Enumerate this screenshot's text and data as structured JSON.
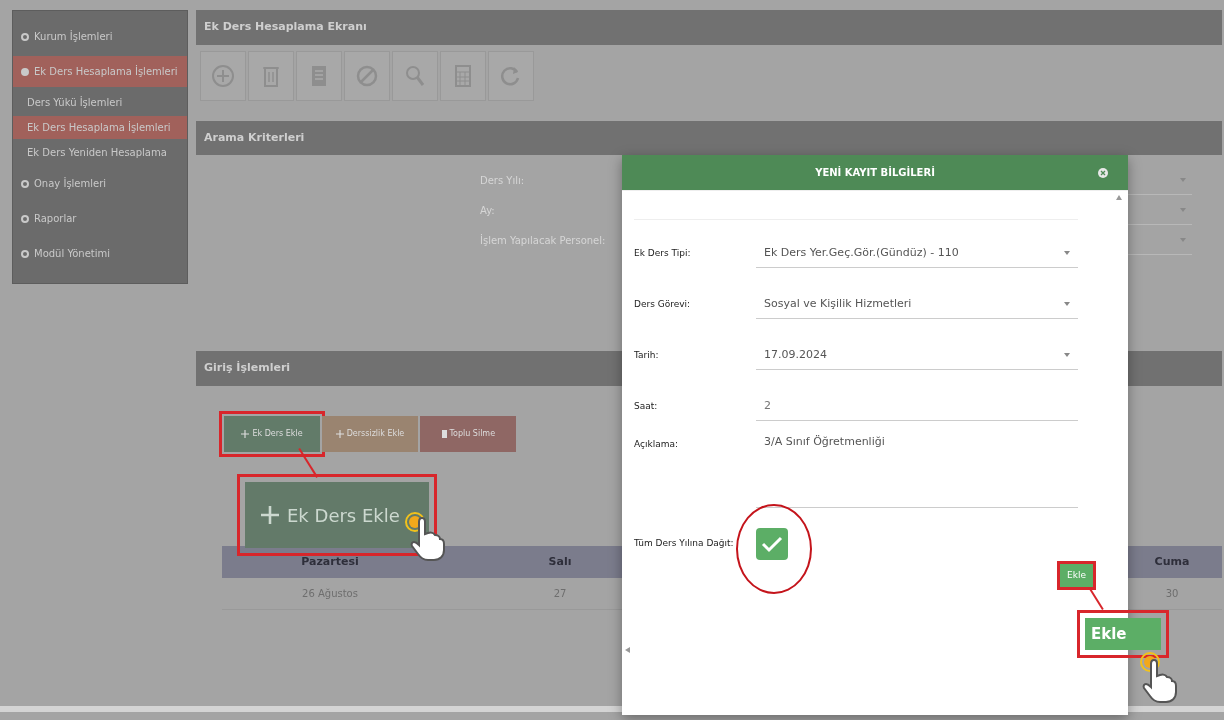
{
  "sidebar": {
    "items": [
      {
        "label": "Kurum İşlemleri",
        "selected": false,
        "expanded": false
      },
      {
        "label": "Ek Ders Hesaplama İşlemleri",
        "selected": true,
        "expanded": true,
        "children": [
          {
            "label": "Ders Yükü İşlemleri",
            "selected": false
          },
          {
            "label": "Ek Ders Hesaplama İşlemleri",
            "selected": true
          },
          {
            "label": "Ek Ders Yeniden Hesaplama",
            "selected": false
          }
        ]
      },
      {
        "label": "Onay İşlemleri",
        "selected": false,
        "expanded": false
      },
      {
        "label": "Raporlar",
        "selected": false,
        "expanded": false
      },
      {
        "label": "Modül Yönetimi",
        "selected": false,
        "expanded": false
      }
    ]
  },
  "page": {
    "title": "Ek Ders Hesaplama Ekranı",
    "toolbar": [
      {
        "kind": "add"
      },
      {
        "kind": "delete"
      },
      {
        "kind": "document"
      },
      {
        "kind": "cancel"
      },
      {
        "kind": "search"
      },
      {
        "kind": "calculator"
      },
      {
        "kind": "refresh"
      }
    ]
  },
  "search_panel": {
    "title": "Arama Kriterleri",
    "fields": [
      {
        "label": "Ders Yılı:"
      },
      {
        "label": "Ay:"
      },
      {
        "label": "İşlem Yapılacak Personel:"
      }
    ]
  },
  "entry_panel": {
    "title": "Giriş İşlemleri",
    "buttons": [
      {
        "label": "Ek Ders Ekle",
        "kind": "add",
        "highlighted": true
      },
      {
        "label": "Derssizlik Ekle",
        "kind": "add",
        "highlighted": false
      },
      {
        "label": "Toplu Silme",
        "kind": "delete",
        "highlighted": false
      }
    ]
  },
  "schedule": {
    "columns": [
      "Pazartesi",
      "Salı",
      "Cuma"
    ],
    "rows": [
      [
        "26 Ağustos",
        "27",
        "30"
      ]
    ]
  },
  "modal": {
    "title": "YENİ KAYIT BİLGİLERİ",
    "fields": [
      {
        "kind": "select",
        "label": "Ek Ders Tipi:",
        "value": "Ek Ders Yer.Geç.Gör.(Gündüz) - 110"
      },
      {
        "kind": "select",
        "label": "Ders Görevi:",
        "value": "Sosyal ve Kişilik Hizmetleri"
      },
      {
        "kind": "select",
        "label": "Tarih:",
        "value": "17.09.2024"
      },
      {
        "kind": "input",
        "label": "Saat:",
        "placeholder": "2"
      },
      {
        "kind": "textarea",
        "label": "Açıklama:",
        "value": "3/A Sınıf Öğretmenliği"
      },
      {
        "kind": "checkbox",
        "label": "Tüm Ders Yılına Dağıt:",
        "checked": true,
        "highlighted": true
      }
    ],
    "submit": {
      "label": "Ekle",
      "highlighted": true
    }
  },
  "callouts": [
    {
      "label": "Ek Ders Ekle",
      "kind": "add"
    },
    {
      "label": "Ekle",
      "kind": "plain"
    }
  ]
}
